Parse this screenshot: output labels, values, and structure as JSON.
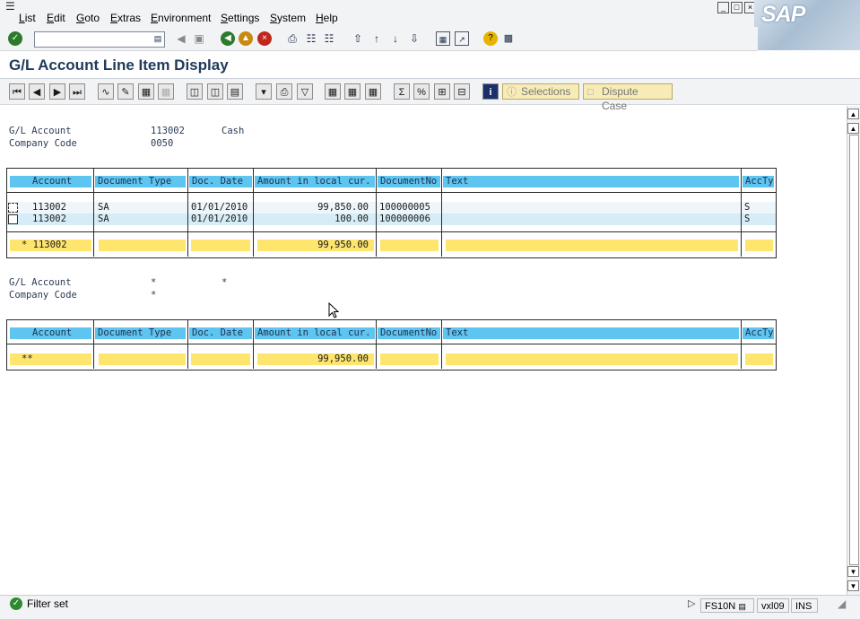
{
  "menu": {
    "items": [
      "List",
      "Edit",
      "Goto",
      "Extras",
      "Environment",
      "Settings",
      "System",
      "Help"
    ]
  },
  "logo": "SAP",
  "command_field": {
    "value": ""
  },
  "title": "G/L Account Line Item Display",
  "app_toolbar": {
    "selections_label": "Selections",
    "dispute_case_label": "Dispute Case"
  },
  "header1": {
    "gl_account_label": "G/L Account",
    "gl_account_value": "113002",
    "gl_account_name": "Cash",
    "company_code_label": "Company Code",
    "company_code_value": "0050"
  },
  "columns": [
    "Account",
    "Document Type",
    "Doc. Date",
    "Amount in local cur.",
    "DocumentNo",
    "Text",
    "AccTy"
  ],
  "table1": {
    "rows": [
      {
        "account": "113002",
        "doc_type": "SA",
        "doc_date": "01/01/2010",
        "amount": "99,850.00",
        "doc_no": "100000005",
        "text": "",
        "accty": "S"
      },
      {
        "account": "113002",
        "doc_type": "SA",
        "doc_date": "01/01/2010",
        "amount": "100.00",
        "doc_no": "100000006",
        "text": "",
        "accty": "S"
      }
    ],
    "subtotal": {
      "account": "* 113002",
      "amount": "99,950.00"
    }
  },
  "header2": {
    "gl_account_label": "G/L Account",
    "gl_account_value": "*",
    "gl_account_name": "*",
    "company_code_label": "Company Code",
    "company_code_value": "*"
  },
  "table2": {
    "total": {
      "account": "**",
      "amount": "99,950.00"
    }
  },
  "status": {
    "message": "Filter set",
    "transaction": "FS10N",
    "server": "vxl09",
    "mode": "INS"
  },
  "colors": {
    "column_header": "#5ec4f0",
    "total_row": "#fde56e",
    "title_text": "#1f3a5a"
  }
}
